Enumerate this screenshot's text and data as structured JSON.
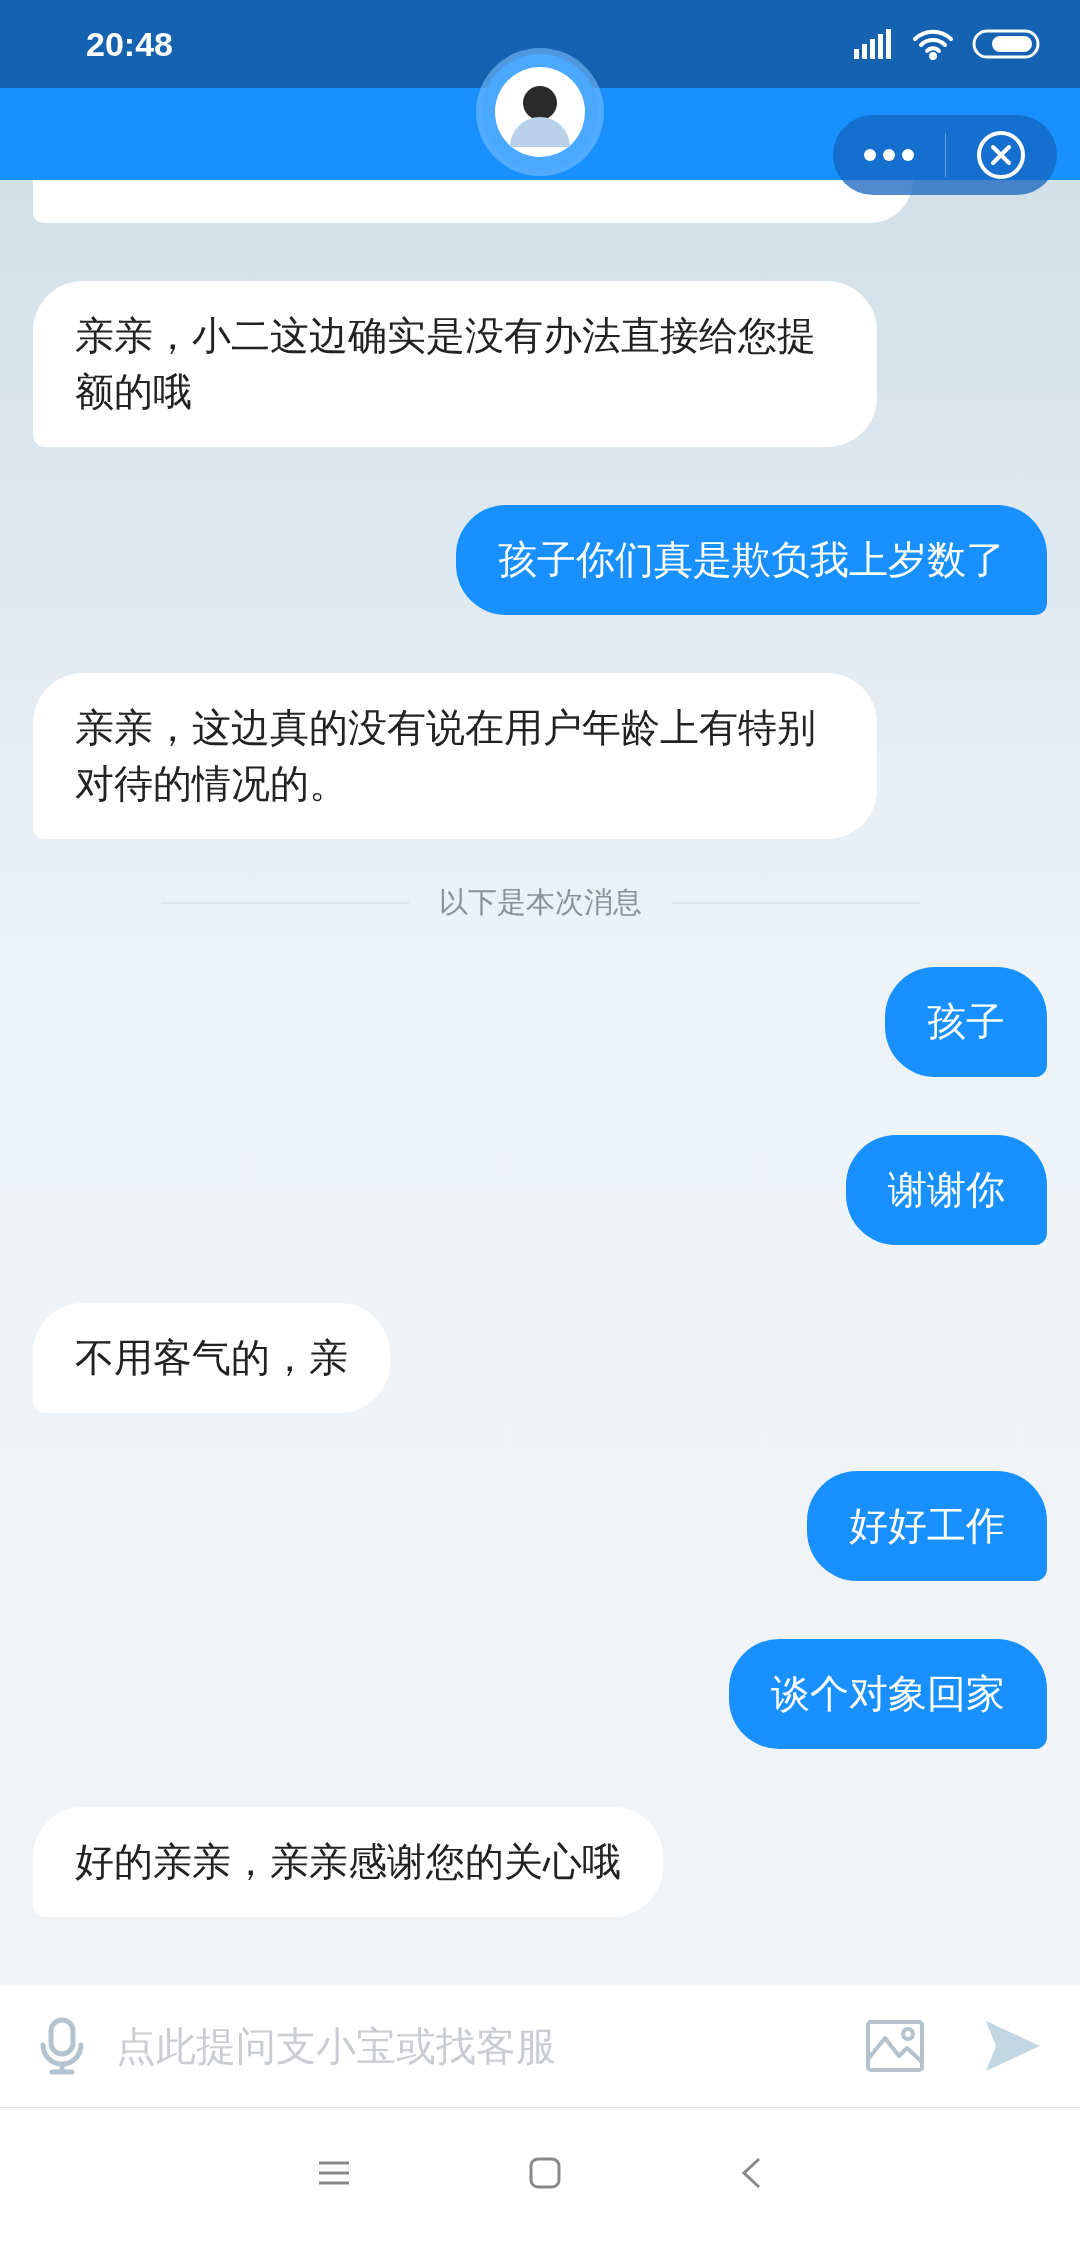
{
  "status_bar": {
    "time": "20:48"
  },
  "messages": [
    {
      "kind": "partial"
    },
    {
      "kind": "received",
      "text": "亲亲，小二这边确实是没有办法直接给您提额的哦"
    },
    {
      "kind": "sent",
      "text": "孩子你们真是欺负我上岁数了"
    },
    {
      "kind": "received",
      "text": "亲亲，这边真的没有说在用户年龄上有特别对待的情况的。"
    },
    {
      "kind": "divider",
      "text": "以下是本次消息"
    },
    {
      "kind": "sent",
      "text": "孩子"
    },
    {
      "kind": "sent",
      "text": "谢谢你"
    },
    {
      "kind": "received",
      "text": "不用客气的，亲"
    },
    {
      "kind": "sent",
      "text": "好好工作"
    },
    {
      "kind": "sent",
      "text": "谈个对象回家"
    },
    {
      "kind": "received",
      "text": "好的亲亲，亲亲感谢您的关心哦"
    }
  ],
  "input": {
    "placeholder": "点此提问支小宝或找客服"
  }
}
